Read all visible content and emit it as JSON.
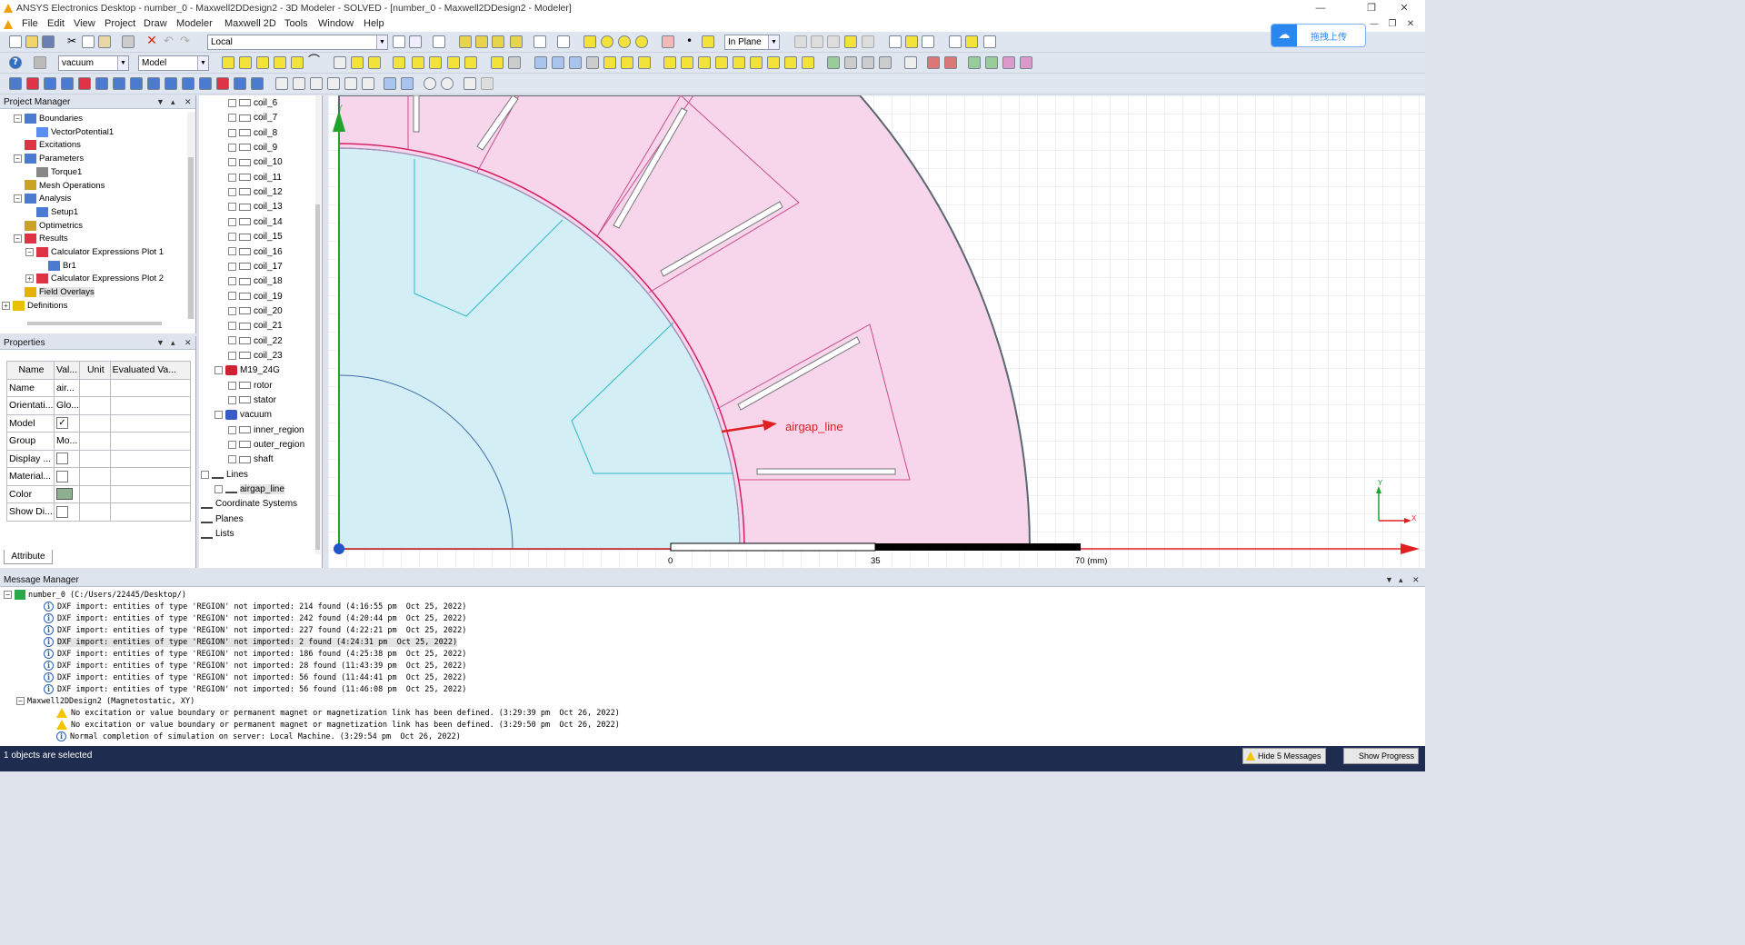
{
  "title": "ANSYS Electronics Desktop - number_0 - Maxwell2DDesign2 - 3D Modeler - SOLVED - [number_0 - Maxwell2DDesign2 - Modeler]",
  "menu": [
    "File",
    "Edit",
    "View",
    "Project",
    "Draw",
    "Modeler",
    "Maxwell 2D",
    "Tools",
    "Window",
    "Help"
  ],
  "toolbar": {
    "coordinate_system": "Local",
    "movement_mode": "In Plane",
    "material": "vacuum",
    "model": "Model",
    "upload_button": "拖拽上传"
  },
  "project_manager": {
    "title": "Project Manager",
    "items": [
      {
        "label": "Boundaries",
        "level": 1,
        "expander": "−"
      },
      {
        "label": "VectorPotential1",
        "level": 2,
        "expander": ""
      },
      {
        "label": "Excitations",
        "level": 1,
        "expander": ""
      },
      {
        "label": "Parameters",
        "level": 1,
        "expander": "−"
      },
      {
        "label": "Torque1",
        "level": 2,
        "expander": ""
      },
      {
        "label": "Mesh Operations",
        "level": 1,
        "expander": ""
      },
      {
        "label": "Analysis",
        "level": 1,
        "expander": "−"
      },
      {
        "label": "Setup1",
        "level": 2,
        "expander": ""
      },
      {
        "label": "Optimetrics",
        "level": 1,
        "expander": ""
      },
      {
        "label": "Results",
        "level": 1,
        "expander": "−"
      },
      {
        "label": "Calculator Expressions Plot 1",
        "level": 2,
        "expander": "−"
      },
      {
        "label": "Br1",
        "level": 3,
        "expander": ""
      },
      {
        "label": "Calculator Expressions Plot 2",
        "level": 2,
        "expander": "+"
      },
      {
        "label": "Field Overlays",
        "level": 1,
        "expander": ""
      },
      {
        "label": "Definitions",
        "level": 0,
        "expander": "+"
      }
    ]
  },
  "properties": {
    "title": "Properties",
    "headers": [
      "Name",
      "Val...",
      "Unit",
      "Evaluated Va..."
    ],
    "rows": [
      {
        "name": "Name",
        "value": "air...",
        "type": "text"
      },
      {
        "name": "Orientati...",
        "value": "Glo...",
        "type": "text"
      },
      {
        "name": "Model",
        "value": "✓",
        "type": "check"
      },
      {
        "name": "Group",
        "value": "Mo...",
        "type": "text"
      },
      {
        "name": "Display ...",
        "value": "",
        "type": "check"
      },
      {
        "name": "Material...",
        "value": "",
        "type": "check"
      },
      {
        "name": "Color",
        "value": "",
        "type": "color"
      },
      {
        "name": "Show Di...",
        "value": "",
        "type": "check"
      }
    ],
    "tab": "Attribute",
    "color_swatch": "#8fb08f"
  },
  "model_tree": {
    "items": [
      {
        "label": "coil_6",
        "level": 2
      },
      {
        "label": "coil_7",
        "level": 2
      },
      {
        "label": "coil_8",
        "level": 2
      },
      {
        "label": "coil_9",
        "level": 2
      },
      {
        "label": "coil_10",
        "level": 2
      },
      {
        "label": "coil_11",
        "level": 2
      },
      {
        "label": "coil_12",
        "level": 2
      },
      {
        "label": "coil_13",
        "level": 2
      },
      {
        "label": "coil_14",
        "level": 2
      },
      {
        "label": "coil_15",
        "level": 2
      },
      {
        "label": "coil_16",
        "level": 2
      },
      {
        "label": "coil_17",
        "level": 2
      },
      {
        "label": "coil_18",
        "level": 2
      },
      {
        "label": "coil_19",
        "level": 2
      },
      {
        "label": "coil_20",
        "level": 2
      },
      {
        "label": "coil_21",
        "level": 2
      },
      {
        "label": "coil_22",
        "level": 2
      },
      {
        "label": "coil_23",
        "level": 2
      },
      {
        "label": "M19_24G",
        "level": 1
      },
      {
        "label": "rotor",
        "level": 2
      },
      {
        "label": "stator",
        "level": 2
      },
      {
        "label": "vacuum",
        "level": 1
      },
      {
        "label": "inner_region",
        "level": 2
      },
      {
        "label": "outer_region",
        "level": 2
      },
      {
        "label": "shaft",
        "level": 2
      },
      {
        "label": "Lines",
        "level": 0
      },
      {
        "label": "airgap_line",
        "level": 1
      },
      {
        "label": "Coordinate Systems",
        "level": 0
      },
      {
        "label": "Planes",
        "level": 0
      },
      {
        "label": "Lists",
        "level": 0
      }
    ]
  },
  "viewport": {
    "annotation": "airgap_line",
    "scale_labels": [
      "0",
      "35",
      "70 (mm)"
    ],
    "axis_y": "Y",
    "axis_x": "X",
    "colors": {
      "stator_fill": "#f7d6ec",
      "rotor_fill": "#d4eef6",
      "airgap_line": "#d4145a",
      "annotation": "#e02020",
      "axis_x": "#e02020",
      "axis_y": "#1fa32a"
    }
  },
  "message_manager": {
    "title": "Message Manager",
    "project": "number_0 (C:/Users/22445/Desktop/)",
    "project_messages": [
      "DXF import: entities of type 'REGION' not imported: 214 found (4:16:55 pm  Oct 25, 2022)",
      "DXF import: entities of type 'REGION' not imported: 242 found (4:20:44 pm  Oct 25, 2022)",
      "DXF import: entities of type 'REGION' not imported: 227 found (4:22:21 pm  Oct 25, 2022)",
      "DXF import: entities of type 'REGION' not imported: 2 found (4:24:31 pm  Oct 25, 2022)",
      "DXF import: entities of type 'REGION' not imported: 186 found (4:25:38 pm  Oct 25, 2022)",
      "DXF import: entities of type 'REGION' not imported: 28 found (11:43:39 pm  Oct 25, 2022)",
      "DXF import: entities of type 'REGION' not imported: 56 found (11:44:41 pm  Oct 25, 2022)",
      "DXF import: entities of type 'REGION' not imported: 56 found (11:46:08 pm  Oct 25, 2022)"
    ],
    "design": "Maxwell2DDesign2 (Magnetostatic, XY)",
    "design_messages": [
      {
        "icon": "warning",
        "text": "No excitation or value boundary or permanent magnet or magnetization link has been defined. (3:29:39 pm  Oct 26, 2022)"
      },
      {
        "icon": "warning",
        "text": "No excitation or value boundary or permanent magnet or magnetization link has been defined. (3:29:50 pm  Oct 26, 2022)"
      },
      {
        "icon": "info",
        "text": "Normal completion of simulation on server: Local Machine. (3:29:54 pm  Oct 26, 2022)"
      }
    ]
  },
  "status": {
    "text": "1 objects are selected",
    "hide_messages": "Hide 5 Messages",
    "show_progress": "Show Progress"
  }
}
